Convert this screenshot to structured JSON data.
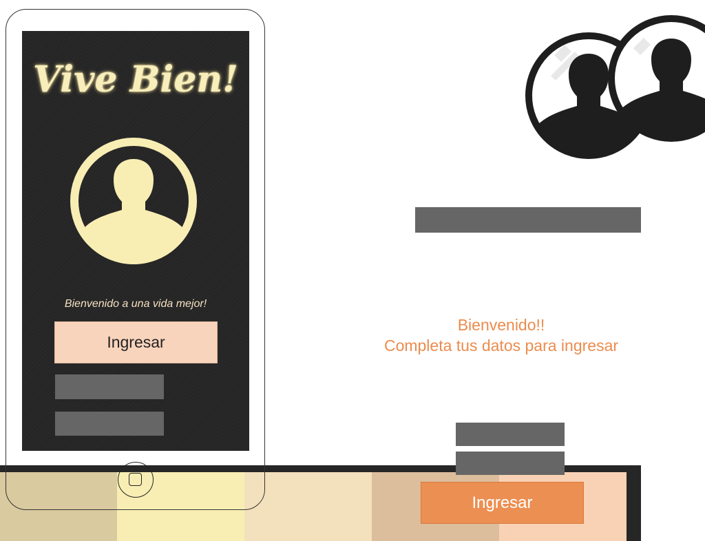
{
  "palette": {
    "colors": [
      "#d9ca9f",
      "#f8eeb4",
      "#f3e0bc",
      "#dcbd9c",
      "#f9d2b5"
    ]
  },
  "phone": {
    "logo_text": "Vive Bien!",
    "welcome_text": "Bienvenido a una vida mejor!",
    "login_button_label": "Ingresar",
    "avatar_icon": "user-circle-icon",
    "home_button_icon": "home-button-icon"
  },
  "main": {
    "users_icon": "users-group-icon",
    "welcome_line1": "Bienvenido!!",
    "welcome_line2": "Completa tus datos para ingresar",
    "login_button_label": "Ingresar"
  },
  "colors": {
    "accent": "#ec8f52",
    "phone_screen": "#252525",
    "field_gray": "#666666",
    "logo_glow": "#f7eebc"
  }
}
